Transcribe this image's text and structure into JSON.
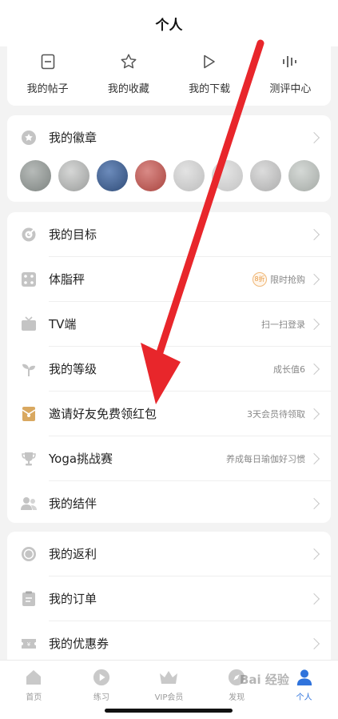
{
  "header": {
    "title": "个人"
  },
  "shortcuts": [
    {
      "label": "我的帖子",
      "icon": "post-icon"
    },
    {
      "label": "我的收藏",
      "icon": "star-icon"
    },
    {
      "label": "我的下载",
      "icon": "download-play-icon"
    },
    {
      "label": "测评中心",
      "icon": "assessment-icon"
    }
  ],
  "badges_section": {
    "label": "我的徽章",
    "badge_colors": [
      "#8c918f",
      "#a8aaa9",
      "#3b5a86",
      "#b8534e",
      "#c9c9c9",
      "#cfcfcf",
      "#bdbdbd",
      "#b7bcb8"
    ]
  },
  "list1": [
    {
      "label": "我的目标",
      "note": "",
      "icon": "target-icon"
    },
    {
      "label": "体脂秤",
      "note": "限时抢购",
      "icon": "scale-icon",
      "promo": "8折"
    },
    {
      "label": "TV端",
      "note": "扫一扫登录",
      "icon": "tv-icon"
    },
    {
      "label": "我的等级",
      "note": "成长值6",
      "icon": "sprout-icon"
    },
    {
      "label": "邀请好友免费领红包",
      "note": "3天会员待领取",
      "icon": "red-envelope-icon"
    },
    {
      "label": "Yoga挑战赛",
      "note": "养成每日瑜伽好习惯",
      "icon": "trophy-icon"
    },
    {
      "label": "我的结伴",
      "note": "",
      "icon": "partner-icon"
    }
  ],
  "list2": [
    {
      "label": "我的返利",
      "icon": "rebate-icon"
    },
    {
      "label": "我的订单",
      "icon": "order-icon"
    },
    {
      "label": "我的优惠券",
      "icon": "coupon-icon"
    }
  ],
  "tabbar": [
    {
      "label": "首页",
      "icon": "home-icon",
      "active": false
    },
    {
      "label": "练习",
      "icon": "play-circle-icon",
      "active": false
    },
    {
      "label": "VIP会员",
      "icon": "crown-icon",
      "active": false
    },
    {
      "label": "发现",
      "icon": "compass-icon",
      "active": false
    },
    {
      "label": "个人",
      "icon": "person-icon",
      "active": true
    }
  ],
  "colors": {
    "accent": "#2f73dc",
    "arrow": "#e8262b",
    "icon_gray": "#bcbcbc"
  },
  "watermark": "Bai 经验"
}
